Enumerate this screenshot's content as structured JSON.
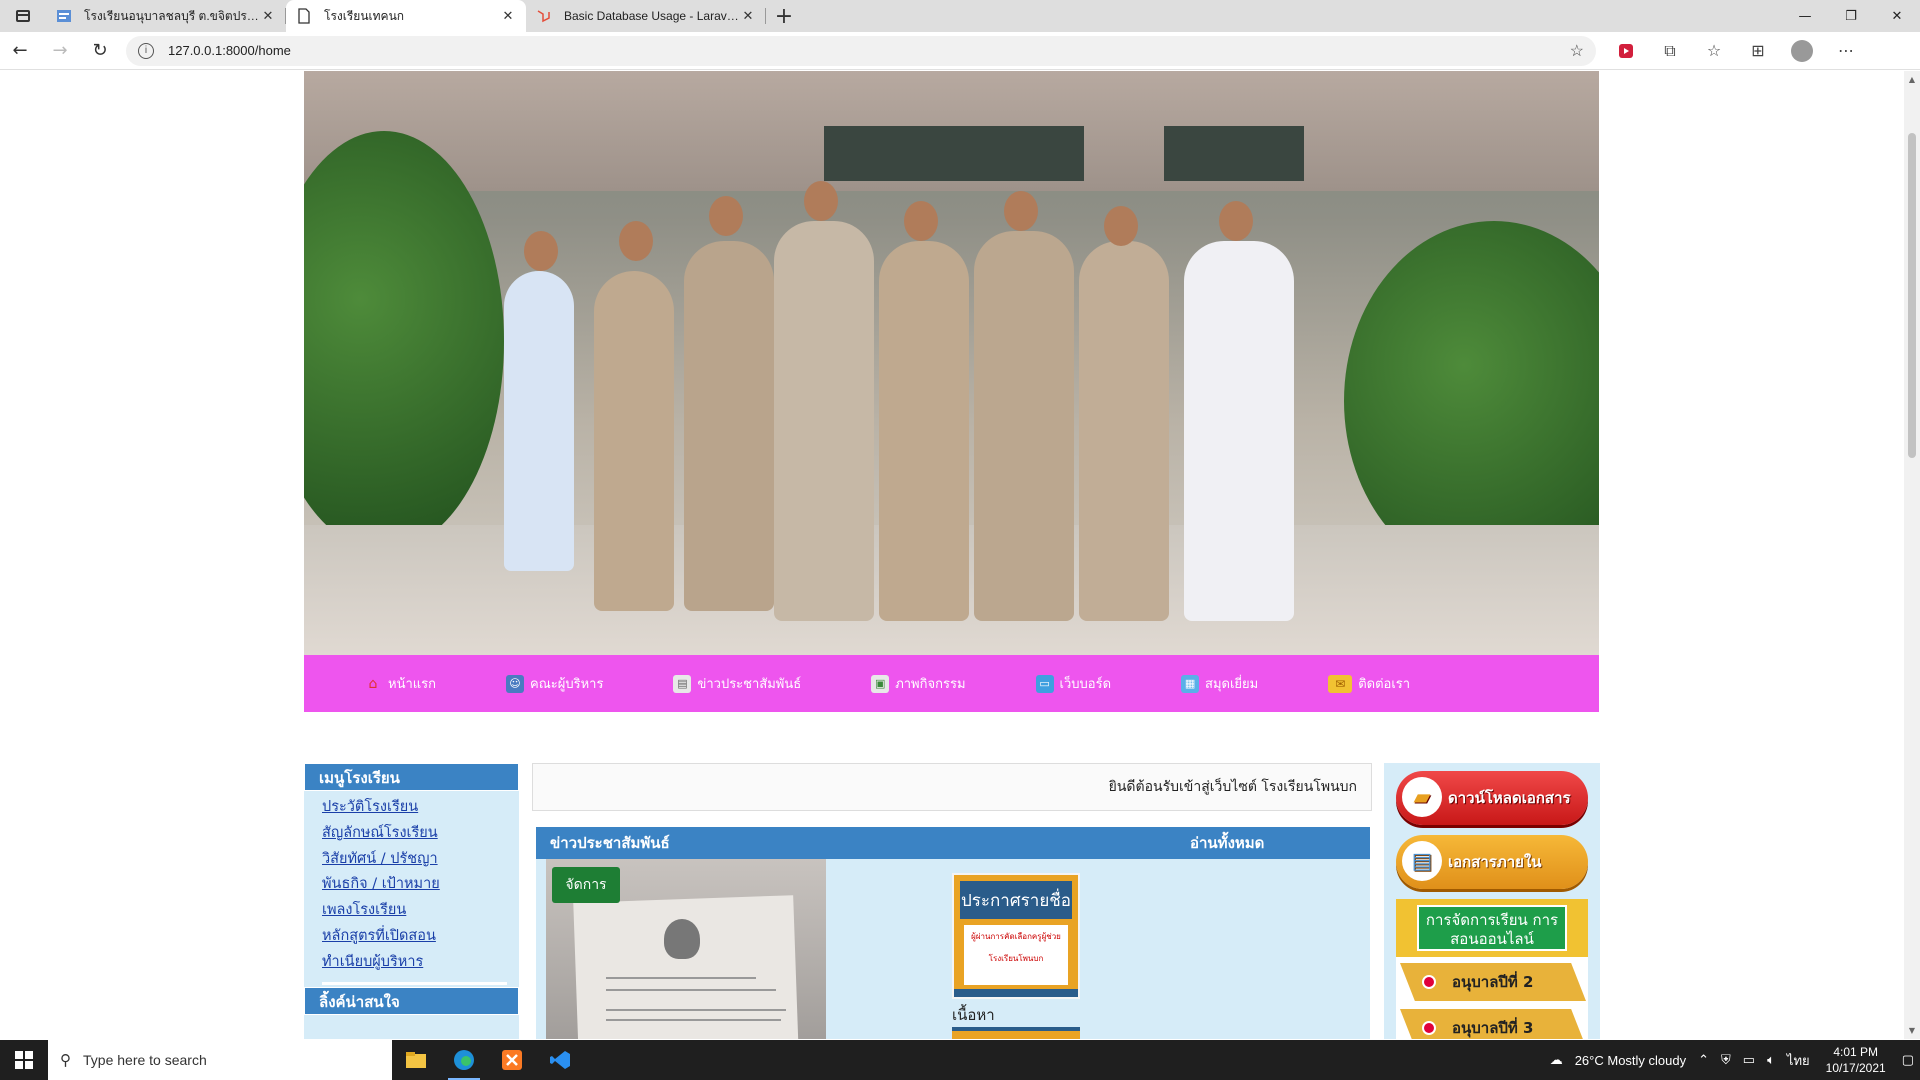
{
  "browser": {
    "tabs": [
      {
        "title": "โรงเรียนอนุบาลชลบุรี ต.ขจิตปราการ อ.",
        "active": false
      },
      {
        "title": "โรงเรียนเทคนก",
        "active": true
      },
      {
        "title": "Basic Database Usage - Laravel -",
        "active": false
      }
    ],
    "new_tab": "+",
    "url": "127.0.0.1:8000/home"
  },
  "site": {
    "nav": [
      {
        "label": "หน้าแรก",
        "icon": "house-icon"
      },
      {
        "label": "คณะผู้บริหาร",
        "icon": "person-card-icon"
      },
      {
        "label": "ข่าวประชาสัมพันธ์",
        "icon": "document-icon"
      },
      {
        "label": "ภาพกิจกรรม",
        "icon": "picture-icon"
      },
      {
        "label": "เว็บบอร์ด",
        "icon": "monitor-icon"
      },
      {
        "label": "สมุดเยี่ยม",
        "icon": "guestbook-icon"
      },
      {
        "label": "ติดต่อเรา",
        "icon": "envelope-icon"
      }
    ],
    "left_menu": {
      "title": "เมนูโรงเรียน",
      "links": [
        "ประวัติโรงเรียน",
        "สัญลักษณ์โรงเรียน",
        "วิสัยทัศน์ / ปรัชญา",
        "พันธกิจ / เป้าหมาย",
        "เพลงโรงเรียน",
        "หลักสูตรที่เปิดสอน",
        "ทำเนียบผู้บริหาร"
      ],
      "links_title": "ลิ้งค์น่าสนใจ"
    },
    "marquee": "ยินดีต้อนรับเข้าสู่เว็บไซต์ โรงเรียนโพนบก",
    "news": {
      "title": "ข่าวประชาสัมพันธ์",
      "read_all": "อ่านทั้งหมด",
      "manage": "จัดการ",
      "thumb_title": "ประกาศรายชื่อ",
      "thumb_text": "ผู้ผ่านการคัดเลือกครูผู้ช่วย",
      "thumb_sub": "โรงเรียนโพนบก",
      "content_label": "เนื้อหา"
    },
    "right": {
      "download": "ดาวน์โหลดเอกสาร",
      "internal": "เอกสารภายใน",
      "online_title": "การจัดการเรียน การสอนออนไลน์",
      "levels": [
        "อนุบาลปีที่ 2",
        "อนุบาลปีที่ 3"
      ]
    }
  },
  "taskbar": {
    "search_placeholder": "Type here to search",
    "weather": "26°C  Mostly cloudy",
    "lang": "ไทย",
    "time": "4:01 PM",
    "date": "10/17/2021"
  },
  "colors": {
    "nav_bg": "#ee55ee",
    "panel_head": "#3b83c4",
    "panel_bg": "#d6ecf8"
  }
}
